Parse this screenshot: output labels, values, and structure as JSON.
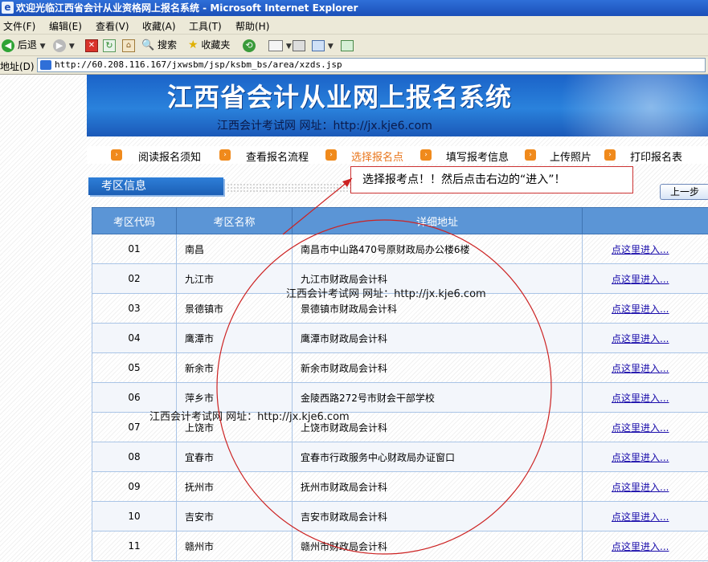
{
  "window": {
    "title": "欢迎光临江西省会计从业资格网上报名系统 - Microsoft Internet Explorer"
  },
  "menu": {
    "items": [
      "文件(F)",
      "编辑(E)",
      "查看(V)",
      "收藏(A)",
      "工具(T)",
      "帮助(H)"
    ]
  },
  "toolbar": {
    "back": "后退",
    "search": "搜索",
    "favorites": "收藏夹"
  },
  "address": {
    "label": "地址(D)",
    "url": "http://60.208.116.167/jxwsbm/jsp/ksbm_bs/area/xzds.jsp"
  },
  "banner": {
    "title": "江西省会计从业网上报名系统",
    "subtitle": "江西会计考试网 网址：http://jx.kje6.com"
  },
  "nav": {
    "steps": [
      "阅读报名须知",
      "查看报名流程",
      "选择报名点",
      "填写报考信息",
      "上传照片",
      "打印报名表"
    ]
  },
  "section": {
    "title": "考区信息"
  },
  "callout": {
    "text": "选择报考点！！然后点击右边的“进入”！"
  },
  "buttons": {
    "back_step": "上一步"
  },
  "table": {
    "headers": [
      "考区代码",
      "考区名称",
      "详细地址",
      ""
    ],
    "action_label": "点这里进入...",
    "rows": [
      {
        "code": "01",
        "name": "南昌",
        "address": "南昌市中山路470号原财政局办公楼6楼"
      },
      {
        "code": "02",
        "name": "九江市",
        "address": "九江市财政局会计科"
      },
      {
        "code": "03",
        "name": "景德镇市",
        "address": "景德镇市财政局会计科"
      },
      {
        "code": "04",
        "name": "鹰潭市",
        "address": "鹰潭市财政局会计科"
      },
      {
        "code": "05",
        "name": "新余市",
        "address": "新余市财政局会计科"
      },
      {
        "code": "06",
        "name": "萍乡市",
        "address": "金陵西路272号市财会干部学校"
      },
      {
        "code": "07",
        "name": "上饶市",
        "address": "上饶市财政局会计科"
      },
      {
        "code": "08",
        "name": "宜春市",
        "address": "宜春市行政服务中心财政局办证窗口"
      },
      {
        "code": "09",
        "name": "抚州市",
        "address": "抚州市财政局会计科"
      },
      {
        "code": "10",
        "name": "吉安市",
        "address": "吉安市财政局会计科"
      },
      {
        "code": "11",
        "name": "赣州市",
        "address": "赣州市财政局会计科"
      }
    ]
  },
  "watermarks": {
    "w1": "江西会计考试网 网址：http://jx.kje6.com",
    "w2": "江西会计考试网 网址：http://jx.kje6.com"
  },
  "colors": {
    "header_blue": "#5b95d6",
    "banner_blue": "#2a82dc",
    "nav_orange": "#f08a1c",
    "annotation_red": "#cc2222"
  }
}
